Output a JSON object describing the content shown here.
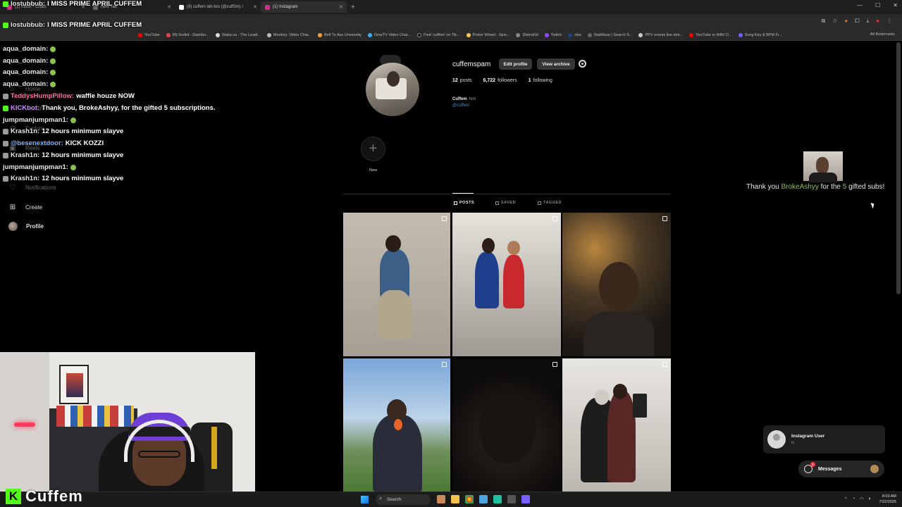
{
  "browser": {
    "tabs": [
      {
        "label": "(1) Inbox • Chats",
        "active": false
      },
      {
        "label": "New Tab",
        "active": false
      },
      {
        "label": "(9) cuffem lah bro (@cuff3m) /",
        "active": false
      },
      {
        "label": "(1) Instagram",
        "active": true
      }
    ],
    "new_tab": "+",
    "bookmarks": [
      "YouTube",
      "IRLToolkit - Dashbo...",
      "Stake.us - The Leadi...",
      "Monkey: Video Chat...",
      "Belt To Ass University",
      "OmeTV Video Chat...",
      "Find 'cuffem' on Tik...",
      "Picker Wheel - Spin...",
      "DistroKid",
      "Twitch",
      "nba",
      "StatMuse | Search S...",
      "PPV events live stre...",
      "YouTube to WAV D...",
      "Song Key & BPM Fi..."
    ],
    "all_bookmarks": "All Bookmarks"
  },
  "sidebar": {
    "items": [
      {
        "label": "Home",
        "icon": "home-icon"
      },
      {
        "label": "Search",
        "icon": "search-icon"
      },
      {
        "label": "Explore",
        "icon": "compass-icon"
      },
      {
        "label": "Reels",
        "icon": "reels-icon"
      },
      {
        "label": "Messages",
        "icon": "messenger-icon"
      },
      {
        "label": "Notifications",
        "icon": "heart-icon"
      },
      {
        "label": "Create",
        "icon": "plus-square-icon"
      },
      {
        "label": "Profile",
        "icon": "avatar"
      }
    ]
  },
  "chat": {
    "messages": [
      {
        "user": "lostubbub:",
        "text": "I MISS PRIME APRIL CUFFEM",
        "color": "#ffffff"
      },
      {
        "user": "lostubbub:",
        "text": "I MISS PRIME APRIL CUFFEM",
        "color": "#ffffff"
      },
      {
        "user": "aqua_domain:",
        "text": "",
        "color": "#ffffff"
      },
      {
        "user": "aqua_domain:",
        "text": "",
        "color": "#ffffff"
      },
      {
        "user": "aqua_domain:",
        "text": "",
        "color": "#ffffff"
      },
      {
        "user": "aqua_domain:",
        "text": "",
        "color": "#ffffff"
      },
      {
        "user": "TeddysHumpPillow:",
        "text": "waffle houze NOW",
        "color": "#ff6fa8"
      },
      {
        "user": "KICKbot:",
        "text": "Thank you, BrokeAshyy, for the gifted 5 subscriptions.",
        "color": "#c98bff"
      },
      {
        "user": "jumpmanjumpman1:",
        "text": "",
        "color": "#e6e6e6"
      },
      {
        "user": "Krash1n:",
        "text": "12 hours minimum slayve",
        "color": "#e6e6e6"
      },
      {
        "user": "@besenextdoor:",
        "text": "KICK KOZZI",
        "color": "#7fb4ff"
      },
      {
        "user": "Krash1n:",
        "text": "12 hours minimum slayve",
        "color": "#e6e6e6"
      },
      {
        "user": "jumpmanjumpman1:",
        "text": "",
        "color": "#e6e6e6"
      },
      {
        "user": "Krash1n:",
        "text": "12 hours minimum slayve",
        "color": "#e6e6e6"
      }
    ]
  },
  "profile": {
    "username": "cuffemspam",
    "edit_profile": "Edit profile",
    "view_archive": "View archive",
    "posts_count": "12",
    "posts_label": "posts",
    "followers_count": "6,722",
    "followers_label": "followers",
    "following_count": "1",
    "following_label": "following",
    "full_name": "Cuffem",
    "pronouns": "him",
    "handle": "@cuffem",
    "new_highlight": "New"
  },
  "tabs": {
    "posts": "POSTS",
    "saved": "SAVED",
    "tagged": "TAGGED"
  },
  "alert": {
    "prefix": "Thank you",
    "name": "BrokeAshyy",
    "mid": "for the",
    "count": "5",
    "suffix": "gifted subs!"
  },
  "notification": {
    "name": "Instagram User",
    "sub": "fa"
  },
  "messages": {
    "label": "Messages",
    "count": "1"
  },
  "stream": {
    "brand": "Cuffem",
    "logo_letter": "K",
    "brand_color": "#53fc18"
  },
  "taskbar": {
    "search": "Search",
    "time": "8:03 AM",
    "date": "7/22/2025"
  }
}
